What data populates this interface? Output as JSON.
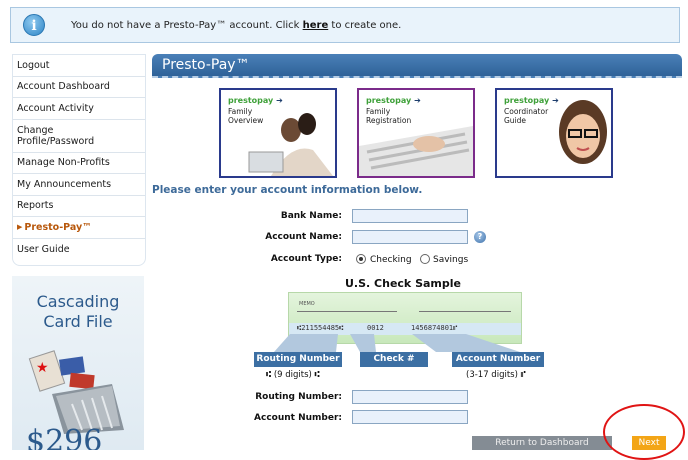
{
  "banner": {
    "message_prefix": "You do not have a Presto-Pay™ account. Click",
    "link": "here",
    "message_suffix": "to create one."
  },
  "sidebar": {
    "items": [
      {
        "label": "Logout"
      },
      {
        "label": "Account Dashboard"
      },
      {
        "label": "Account Activity"
      },
      {
        "label": "Change Profile/Password"
      },
      {
        "label": "Manage Non-Profits"
      },
      {
        "label": "My Announcements"
      },
      {
        "label": "Reports"
      },
      {
        "label": "Presto-Pay™"
      },
      {
        "label": "User Guide"
      }
    ]
  },
  "ad": {
    "line1": "Cascading",
    "line2": "Card File",
    "price": "$296"
  },
  "page_title": "Presto-Pay™",
  "thumbnails": [
    {
      "brand": "prestopay",
      "caption_line1": "Family",
      "caption_line2": "Overview"
    },
    {
      "brand": "prestopay",
      "caption_line1": "Family",
      "caption_line2": "Registration"
    },
    {
      "brand": "prestopay",
      "caption_line1": "Coordinator",
      "caption_line2": "Guide"
    }
  ],
  "prompt": "Please enter your account information below.",
  "form": {
    "bank_name_label": "Bank Name:",
    "account_name_label": "Account Name:",
    "account_type_label": "Account Type:",
    "checking_label": "Checking",
    "savings_label": "Savings",
    "routing_number_label": "Routing Number:",
    "account_number_label": "Account Number:"
  },
  "check": {
    "title": "U.S. Check Sample",
    "memo": "MEMO",
    "micr_routing": "⑆211554485⑆",
    "micr_check": "0012",
    "micr_account": "1456874801⑈",
    "routing_tag": "Routing Number",
    "check_tag": "Check #",
    "account_tag": "Account Number",
    "routing_digits": "(9 digits)",
    "account_digits": "(3-17 digits)"
  },
  "buttons": {
    "return": "Return to Dashboard",
    "next": "Next"
  },
  "colors": {
    "title_bar": "#3a6ea5",
    "next_button": "#f3a516",
    "highlight_circle": "#e01414"
  }
}
